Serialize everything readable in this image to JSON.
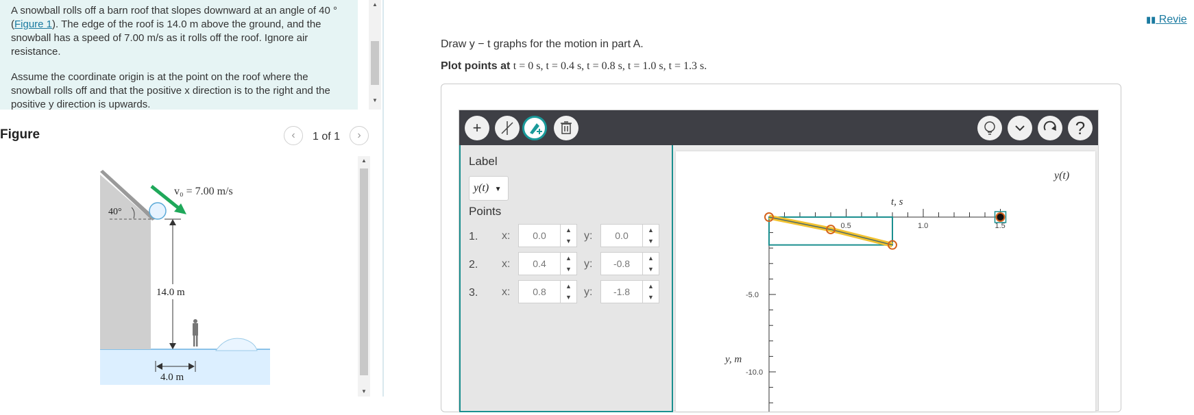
{
  "problem": {
    "paragraph1_part1": "A snowball rolls off a barn roof that slopes downward at an angle of 40 ° (",
    "figure_link": "Figure 1",
    "paragraph1_part2": "). The edge of the roof is 14.0 m above the ground, and the snowball has a speed of 7.00 m/s as it rolls off the roof. Ignore air resistance.",
    "paragraph2": "Assume the coordinate origin is at the point on the roof where the snowball rolls off and that the positive x direction is to the right and the positive y direction is upwards."
  },
  "figure": {
    "title": "Figure",
    "count": "1 of 1",
    "angle_label": "40°",
    "speed_label": "v₀ = 7.00 m/s",
    "height_label": "14.0 m",
    "distance_label": "4.0 m"
  },
  "review_link": "Revie",
  "instructions": {
    "line1": "Draw y − t graphs for the motion in part A.",
    "line2_bold": "Plot points at",
    "line2_math": "t = 0 s, t = 0.4 s, t = 0.8 s, t = 1.0 s, t = 1.3 s."
  },
  "toolbar": {
    "add_icon": "plus-icon",
    "line_icon": "line-icon",
    "draw_icon": "pen-plus-icon",
    "delete_icon": "trash-icon",
    "hint_icon": "lightbulb-icon",
    "more_icon": "chevron-down-icon",
    "reset_icon": "redo-icon",
    "help_icon": "question-icon",
    "help_label": "?"
  },
  "side_panel": {
    "label_heading": "Label",
    "label_value": "y(t)",
    "points_heading": "Points",
    "points": [
      {
        "num": "1.",
        "x": "0.0",
        "y": "0.0"
      },
      {
        "num": "2.",
        "x": "0.4",
        "y": "-0.8"
      },
      {
        "num": "3.",
        "x": "0.8",
        "y": "-1.8"
      }
    ],
    "x_label": "x:",
    "y_label": "y:"
  },
  "graph": {
    "curve_label": "y(t)",
    "t_axis_label": "t, s",
    "y_axis_label": "y, m",
    "t_ticks": [
      "0.5",
      "1.0",
      "1.5"
    ],
    "y_ticks": [
      "-5.0",
      "-10.0"
    ],
    "points": [
      {
        "t": 0.0,
        "y": 0.0
      },
      {
        "t": 0.4,
        "y": -0.8
      },
      {
        "t": 0.8,
        "y": -1.8
      }
    ],
    "extra_marker": {
      "t": 1.5,
      "y": 0.0
    }
  },
  "colors": {
    "accent": "#1a8f8f",
    "curve": "#f2c230",
    "point": "#d4621c",
    "link": "#1a7aa0"
  }
}
